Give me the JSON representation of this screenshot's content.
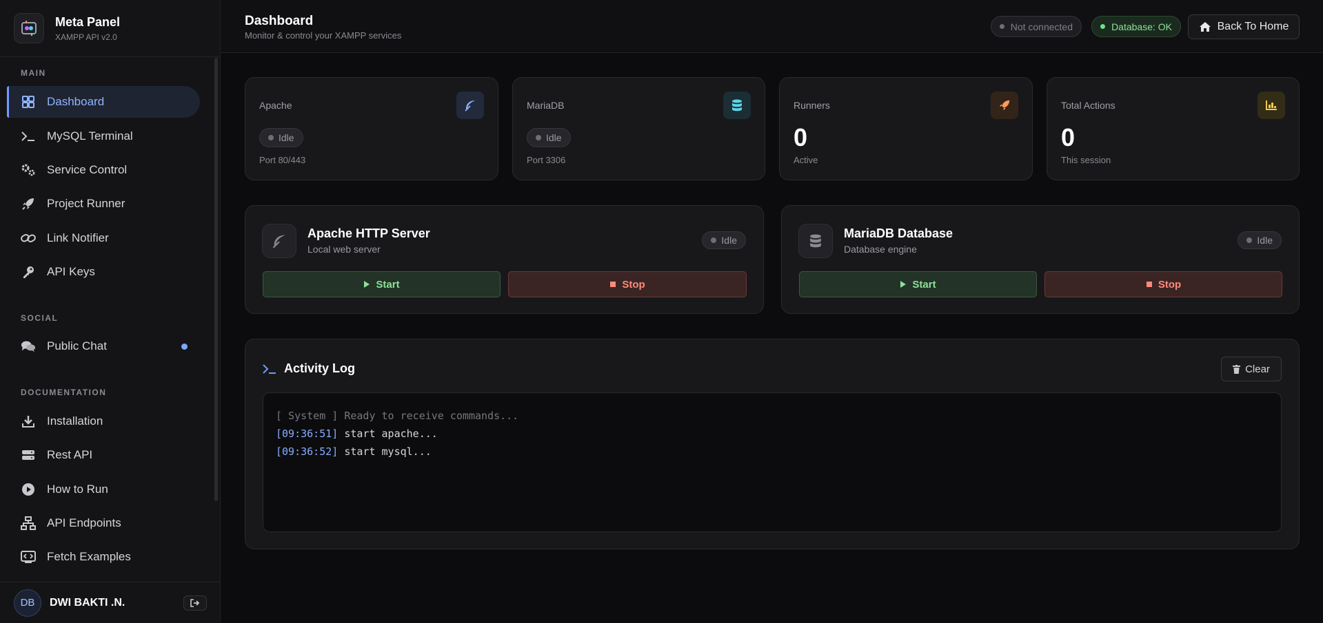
{
  "brand": {
    "title": "Meta Panel",
    "subtitle": "XAMPP API v2.0"
  },
  "sidebar": {
    "sections": {
      "main": "MAIN",
      "social": "SOCIAL",
      "docs": "DOCUMENTATION"
    },
    "items": [
      {
        "label": "Dashboard",
        "icon": "grid-icon",
        "active": true
      },
      {
        "label": "MySQL Terminal",
        "icon": "terminal-icon"
      },
      {
        "label": "Service Control",
        "icon": "gears-icon"
      },
      {
        "label": "Project Runner",
        "icon": "rocket-icon"
      },
      {
        "label": "Link Notifier",
        "icon": "link-icon"
      },
      {
        "label": "API Keys",
        "icon": "key-icon"
      },
      {
        "label": "Public Chat",
        "icon": "chat-icon",
        "unread": true
      },
      {
        "label": "Installation",
        "icon": "download-icon"
      },
      {
        "label": "Rest API",
        "icon": "server-icon"
      },
      {
        "label": "How to Run",
        "icon": "play-circle-icon"
      },
      {
        "label": "API Endpoints",
        "icon": "sitemap-icon"
      },
      {
        "label": "Fetch Examples",
        "icon": "code-window-icon"
      }
    ]
  },
  "user": {
    "initials": "DB",
    "name": "DWI BAKTI .N."
  },
  "header": {
    "title": "Dashboard",
    "subtitle": "Monitor & control your XAMPP services",
    "connection_status": "Not connected",
    "db_status": "Database: OK",
    "home_label": "Back To Home"
  },
  "stats": [
    {
      "label": "Apache",
      "status": "Idle",
      "sub": "Port 80/443",
      "icon": "feather-icon",
      "accent": "#8fb4ff"
    },
    {
      "label": "MariaDB",
      "status": "Idle",
      "sub": "Port 3306",
      "icon": "database-icon",
      "accent": "#5fd3e8"
    },
    {
      "label": "Runners",
      "value": "0",
      "sub": "Active",
      "icon": "rocket-icon",
      "accent": "#ff9a5a"
    },
    {
      "label": "Total Actions",
      "value": "0",
      "sub": "This session",
      "icon": "chart-icon",
      "accent": "#f2c94c"
    }
  ],
  "services": [
    {
      "title": "Apache HTTP Server",
      "subtitle": "Local web server",
      "status": "Idle",
      "start": "Start",
      "stop": "Stop",
      "icon": "feather-icon"
    },
    {
      "title": "MariaDB Database",
      "subtitle": "Database engine",
      "status": "Idle",
      "start": "Start",
      "stop": "Stop",
      "icon": "database-icon"
    }
  ],
  "activity": {
    "title": "Activity Log",
    "clear_label": "Clear",
    "system_line": "[ System ] Ready to receive commands...",
    "entries": [
      {
        "time": "[09:36:51]",
        "msg": "start apache..."
      },
      {
        "time": "[09:36:52]",
        "msg": "start mysql..."
      }
    ]
  },
  "colors": {
    "accent": "#6f9bff",
    "ok": "#8fe09a",
    "danger": "#ff8a7a"
  }
}
